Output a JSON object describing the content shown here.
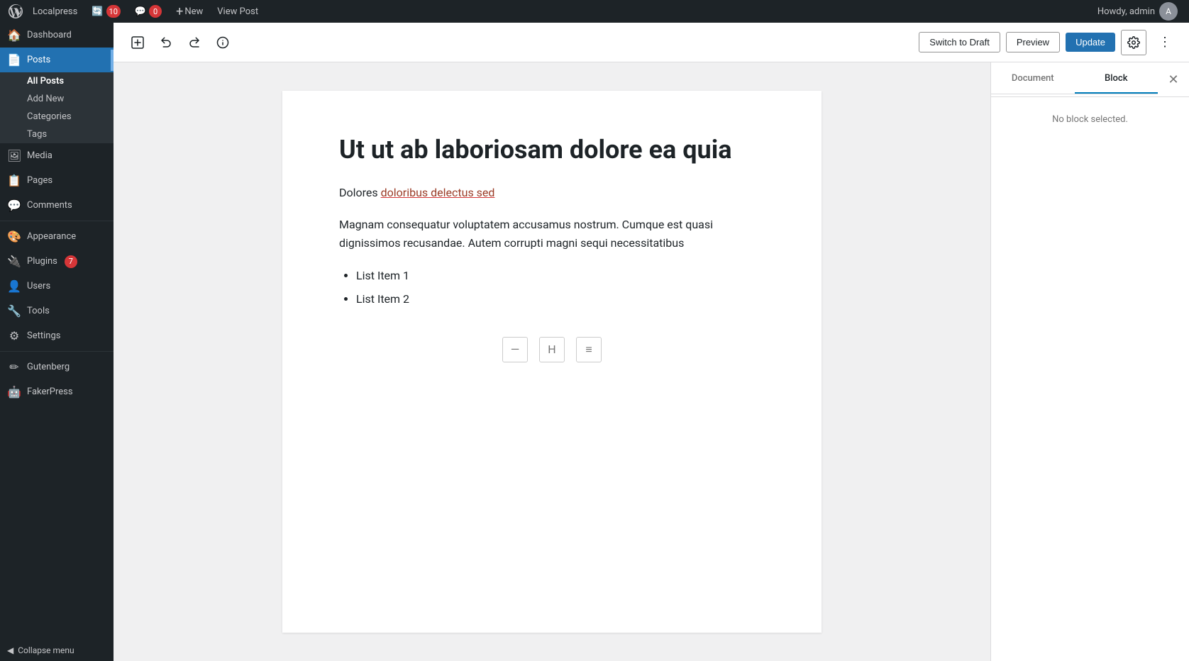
{
  "adminbar": {
    "site_name": "Localpress",
    "updates_count": "10",
    "comments_count": "0",
    "new_label": "New",
    "view_post_label": "View Post",
    "howdy_label": "Howdy, admin"
  },
  "sidebar": {
    "dashboard_label": "Dashboard",
    "posts_label": "Posts",
    "all_posts_label": "All Posts",
    "add_new_label": "Add New",
    "categories_label": "Categories",
    "tags_label": "Tags",
    "media_label": "Media",
    "pages_label": "Pages",
    "comments_label": "Comments",
    "appearance_label": "Appearance",
    "plugins_label": "Plugins",
    "plugins_badge": "7",
    "users_label": "Users",
    "tools_label": "Tools",
    "settings_label": "Settings",
    "gutenberg_label": "Gutenberg",
    "fakerpress_label": "FakerPress",
    "collapse_label": "Collapse menu"
  },
  "toolbar": {
    "switch_draft_label": "Switch to Draft",
    "preview_label": "Preview",
    "update_label": "Update"
  },
  "editor": {
    "post_title": "Ut ut ab laboriosam dolore ea quia",
    "para1": "Dolores ",
    "para1_link_text": "doloribus delectus sed",
    "para2": "Magnam consequatur voluptatem accusamus nostrum. Cumque est quasi dignissimos recusandae. Autem corrupti magni sequi necessitatibus",
    "list_items": [
      "List Item 1",
      "List Item 2"
    ]
  },
  "right_panel": {
    "document_tab": "Document",
    "block_tab": "Block",
    "no_block_selected": "No block selected."
  }
}
